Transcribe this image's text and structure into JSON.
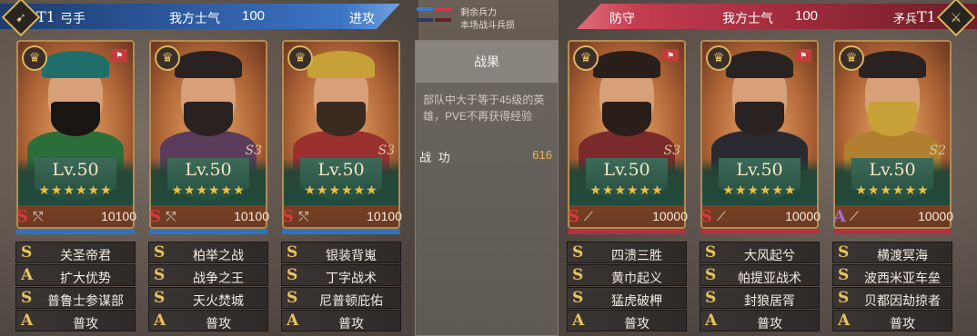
{
  "left": {
    "tier": "T1",
    "troop_type": "弓手",
    "morale_label": "我方士气",
    "morale_value": "100",
    "stance": "进攻",
    "heroes": [
      {
        "level": "Lv.50",
        "stars": "★★★★★★",
        "tag": "",
        "grade": "S",
        "troops": "10100",
        "skills": [
          {
            "g": "S",
            "n": "关圣帝君"
          },
          {
            "g": "A",
            "n": "扩大优势"
          },
          {
            "g": "S",
            "n": "普鲁士参谋部"
          },
          {
            "g": "A",
            "n": "普攻"
          }
        ]
      },
      {
        "level": "Lv.50",
        "stars": "★★★★★★",
        "tag": "S3",
        "grade": "S",
        "troops": "10100",
        "skills": [
          {
            "g": "S",
            "n": "柏举之战"
          },
          {
            "g": "S",
            "n": "战争之王"
          },
          {
            "g": "S",
            "n": "天火焚城"
          },
          {
            "g": "A",
            "n": "普攻"
          }
        ]
      },
      {
        "level": "Lv.50",
        "stars": "★★★★★★",
        "tag": "S3",
        "grade": "S",
        "troops": "10100",
        "skills": [
          {
            "g": "S",
            "n": "银装背嵬"
          },
          {
            "g": "S",
            "n": "丁字战术"
          },
          {
            "g": "S",
            "n": "尼普顿庇佑"
          },
          {
            "g": "A",
            "n": "普攻"
          }
        ]
      }
    ]
  },
  "right": {
    "tier": "T1",
    "troop_type": "矛兵",
    "morale_label": "我方士气",
    "morale_value": "100",
    "stance": "防守",
    "heroes": [
      {
        "level": "Lv.50",
        "stars": "★★★★★★",
        "tag": "S3",
        "grade": "S",
        "troops": "10000",
        "skills": [
          {
            "g": "S",
            "n": "四溃三胜"
          },
          {
            "g": "S",
            "n": "黄巾起义"
          },
          {
            "g": "S",
            "n": "猛虎破柙"
          },
          {
            "g": "A",
            "n": "普攻"
          }
        ]
      },
      {
        "level": "Lv.50",
        "stars": "★★★★★★",
        "tag": "",
        "grade": "S",
        "troops": "10000",
        "skills": [
          {
            "g": "S",
            "n": "大风起兮"
          },
          {
            "g": "S",
            "n": "帕提亚战术"
          },
          {
            "g": "S",
            "n": "封狼居胥"
          },
          {
            "g": "A",
            "n": "普攻"
          }
        ]
      },
      {
        "level": "Lv.50",
        "stars": "★★★★★★",
        "tag": "S2",
        "grade": "A",
        "troops": "10000",
        "skills": [
          {
            "g": "S",
            "n": "横渡冥海"
          },
          {
            "g": "S",
            "n": "波西米亚车垒"
          },
          {
            "g": "S",
            "n": "贝都因劫掠者"
          },
          {
            "g": "A",
            "n": "普攻"
          }
        ]
      }
    ]
  },
  "center": {
    "remaining_troops": "剩余兵力",
    "battle_losses": "本场战斗兵损",
    "result_title": "战果",
    "note": "部队中大于等于45级的英雄，PVE不再获得经验",
    "merit_label": "战 功",
    "merit_value": "616"
  },
  "colors": {
    "left_accent": "#2b5699",
    "right_accent": "#b3303f",
    "gold": "#e9c25c"
  },
  "icons": {
    "crown": "crown-icon",
    "sword": "sword-icon",
    "spear": "spear-icon",
    "bow": "bow-icon",
    "flag": "flag-icon"
  }
}
